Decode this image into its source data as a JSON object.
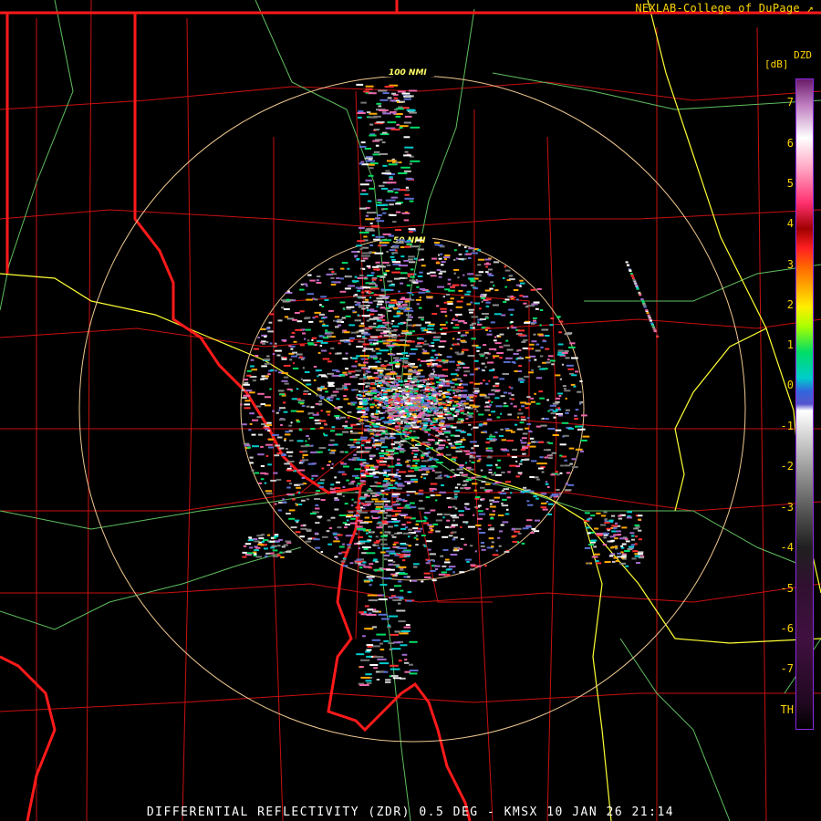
{
  "credit": "NEXLAB-College of DuPage",
  "footer": "DIFFERENTIAL REFLECTIVITY (ZDR) 0.5 DEG - KMSX 10 JAN 26 21:14",
  "legend": {
    "product": "DZD",
    "unit": "[dB]",
    "ticks": [
      "7",
      "6",
      "5",
      "4",
      "3",
      "2",
      "1",
      "0",
      "-1",
      "-2",
      "-3",
      "-4",
      "-5",
      "-6",
      "-7",
      "TH"
    ]
  },
  "rings": {
    "outer_label": "100 NMI",
    "inner_label": "50 NMI"
  },
  "colors": {
    "state_borders": "#ff1a1a",
    "county_borders": "#cc1010",
    "highways": "#ffff33",
    "rivers": "#66cc66",
    "range_rings": "#f0c890",
    "text": "#ffd400"
  }
}
